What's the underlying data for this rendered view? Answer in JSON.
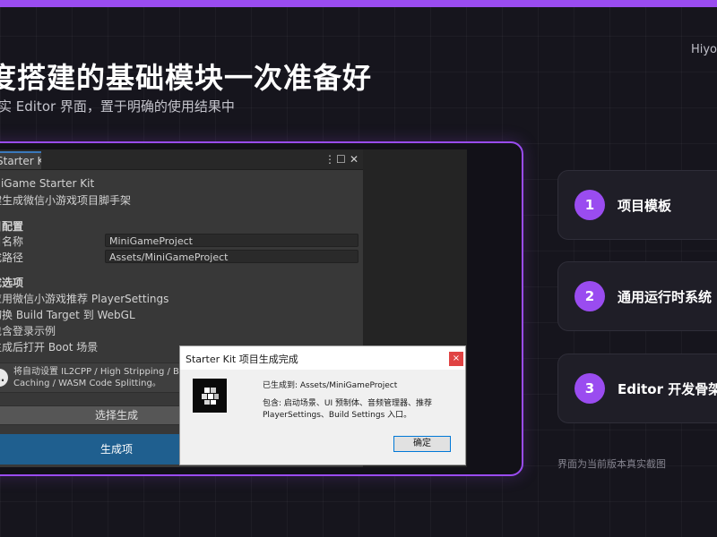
{
  "slide": {
    "brand": "Hiyo",
    "headline": "度搭建的基础模块一次准备好",
    "subline": "实 Editor 界面，置于明确的使用结果中",
    "caption": "界面为当前版本真实截图",
    "accent_color": "#9a4cf0"
  },
  "unity": {
    "tab_label": "Starter Kit",
    "window_controls": [
      "⋮",
      "☐",
      "✕"
    ],
    "heading": "iniGame Starter Kit",
    "subheading": "键生成微信小游戏项目脚手架",
    "project_section": "目配置",
    "fields": [
      {
        "label": "目名称",
        "value": "MiniGameProject"
      },
      {
        "label": "成路径",
        "value": "Assets/MiniGameProject"
      }
    ],
    "options_section": "成选项",
    "options": [
      "应用微信小游戏推荐 PlayerSettings",
      "切换 Build Target 到 WebGL",
      "包含登录示例",
      "生成后打开 Boot 场景"
    ],
    "help_line1": "将自动设置 IL2CPP / High Stripping / Brotli /",
    "help_line2": "Caching / WASM Code Splitting。",
    "choose_button": "选择生成",
    "generate_button": "生成项"
  },
  "dialog": {
    "title": "Starter Kit 项目生成完成",
    "close_label": "×",
    "message_line1": "已生成到: Assets/MiniGameProject",
    "message_line2": "包含: 启动场景、UI 预制体、音频管理器、推荐",
    "message_line3": "PlayerSettings、Build Settings 入口。",
    "ok_button": "确定"
  },
  "cards": [
    {
      "number": "1",
      "label": "项目模板"
    },
    {
      "number": "2",
      "label": "通用运行时系统"
    },
    {
      "number": "3",
      "label": "Editor 开发骨架"
    }
  ]
}
